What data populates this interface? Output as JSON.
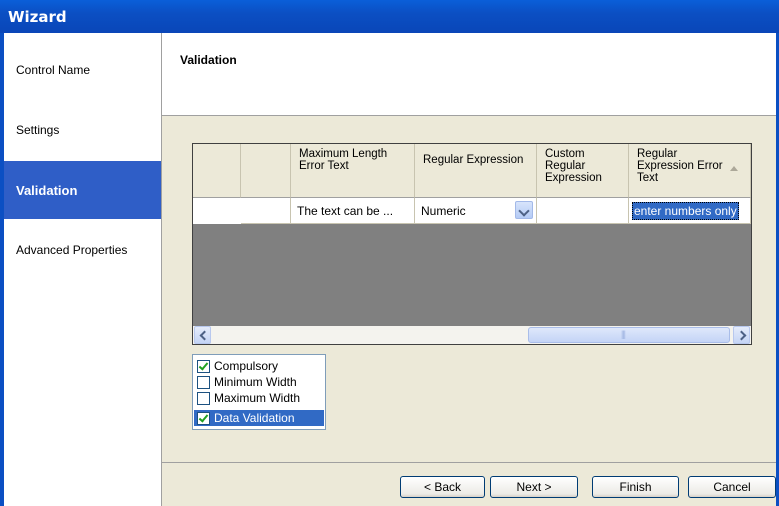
{
  "window": {
    "title": "Wizard"
  },
  "nav": {
    "items": [
      {
        "label": "Control Name",
        "active": false
      },
      {
        "label": "Settings",
        "active": false
      },
      {
        "label": "Validation",
        "active": true
      },
      {
        "label": "Advanced Properties",
        "active": false
      }
    ]
  },
  "page": {
    "title": "Validation"
  },
  "grid": {
    "columns": [
      "",
      "Maximum Length Error Text",
      "Regular Expression",
      "Custom Regular Expression",
      "Regular Expression Error Text"
    ],
    "rows": [
      {
        "current": true,
        "cells": [
          "",
          "The text can be ...",
          "Numeric",
          "",
          "enter numbers only"
        ]
      }
    ]
  },
  "checklist": {
    "items": [
      {
        "label": "Compulsory",
        "checked": true,
        "selected": false
      },
      {
        "label": "Minimum Width",
        "checked": false,
        "selected": false
      },
      {
        "label": "Maximum Width",
        "checked": false,
        "selected": false
      },
      {
        "label": "Data Validation",
        "checked": true,
        "selected": true
      }
    ]
  },
  "buttons": {
    "back": "< Back",
    "next": "Next >",
    "finish": "Finish",
    "cancel": "Cancel"
  },
  "colors": {
    "titlebar": "#0b4fc3",
    "nav_active": "#2f5ec7",
    "selection": "#316ac5",
    "grid_empty": "#808080"
  }
}
